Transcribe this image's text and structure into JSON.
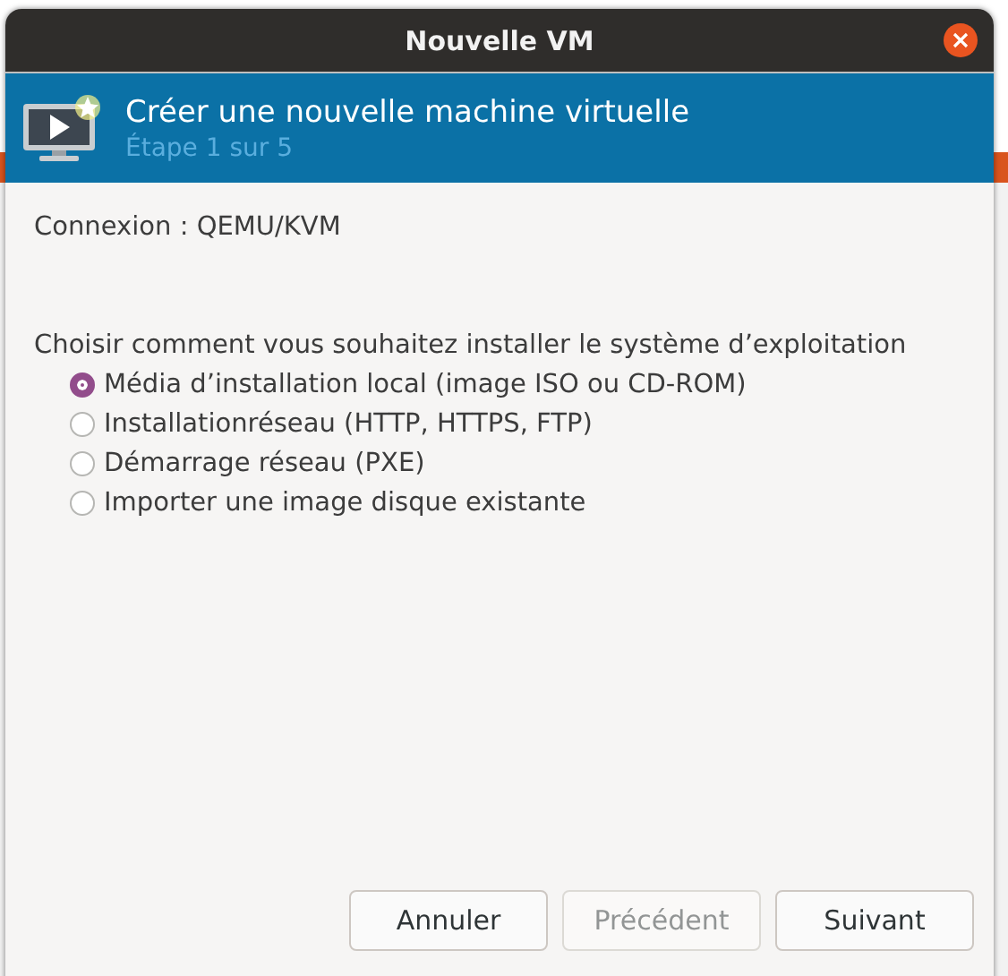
{
  "window": {
    "title": "Nouvelle VM"
  },
  "header": {
    "title": "Créer une nouvelle machine virtuelle",
    "subtitle": "Étape 1 sur 5"
  },
  "connection": "Connexion : QEMU/KVM",
  "prompt": "Choisir comment vous souhaitez installer le système d’exploitation",
  "options": [
    {
      "label": "Média d’installation local (image ISO ou CD-ROM)",
      "selected": true
    },
    {
      "label": "Installationréseau (HTTP, HTTPS, FTP)",
      "selected": false
    },
    {
      "label": "Démarrage réseau (PXE)",
      "selected": false
    },
    {
      "label": "Importer une image disque existante",
      "selected": false
    }
  ],
  "buttons": [
    {
      "label": "Annuler",
      "disabled": false
    },
    {
      "label": "Précédent",
      "disabled": true
    },
    {
      "label": "Suivant",
      "disabled": false
    }
  ]
}
